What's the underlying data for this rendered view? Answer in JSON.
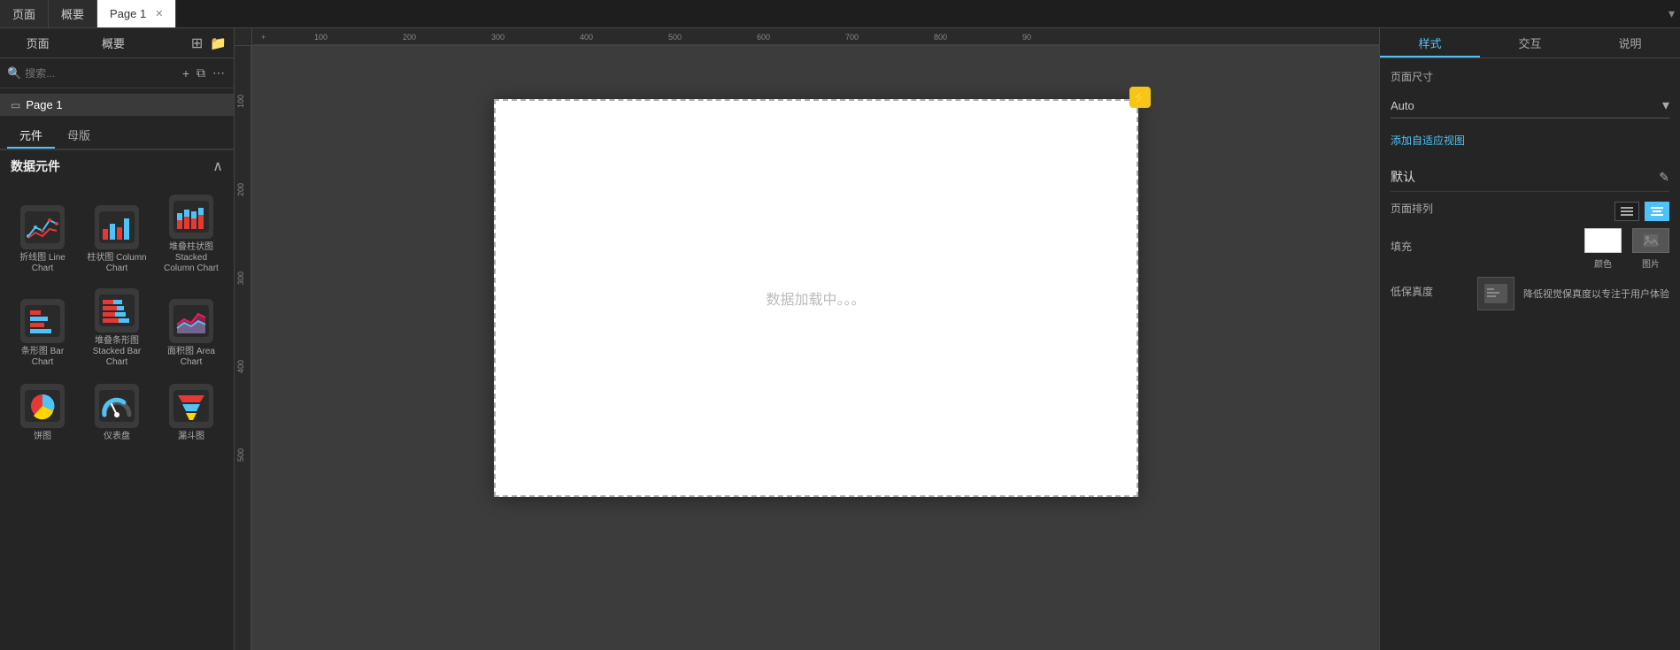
{
  "topBar": {
    "tabs": [
      {
        "id": "page",
        "label": "页面",
        "active": false
      },
      {
        "id": "overview",
        "label": "概要",
        "active": false
      },
      {
        "id": "page1",
        "label": "Page 1",
        "active": true,
        "closable": true
      }
    ],
    "scrollBtn": "▾"
  },
  "leftSidebar": {
    "navTabs": [
      {
        "id": "pages",
        "label": "页面",
        "active": false
      },
      {
        "id": "overview",
        "label": "概要",
        "active": false
      }
    ],
    "search": {
      "placeholder": "搜索...",
      "addIcon": "+",
      "copyIcon": "⧉",
      "moreIcon": "⋯"
    },
    "pages": [
      {
        "id": "page1",
        "label": "Page 1",
        "active": true
      }
    ],
    "componentsTabs": [
      {
        "id": "elements",
        "label": "元件",
        "active": true
      },
      {
        "id": "master",
        "label": "母版",
        "active": false
      }
    ],
    "dataSection": {
      "title": "数据元件",
      "toggleIcon": "∧"
    },
    "components": [
      {
        "id": "line-chart",
        "label": "折线图 Line Chart",
        "iconType": "line-chart"
      },
      {
        "id": "column-chart",
        "label": "柱状图 Column Chart",
        "iconType": "column-chart"
      },
      {
        "id": "stacked-column",
        "label": "堆叠柱状图 Stacked Column Chart",
        "iconType": "stacked-column"
      },
      {
        "id": "bar-chart",
        "label": "条形图 Bar Chart",
        "iconType": "bar-chart"
      },
      {
        "id": "stacked-bar",
        "label": "堆叠条形图 Stacked Bar Chart",
        "iconType": "stacked-bar"
      },
      {
        "id": "area-chart",
        "label": "面积图 Area Chart",
        "iconType": "area-chart"
      },
      {
        "id": "pie-chart",
        "label": "饼图",
        "iconType": "pie-chart"
      },
      {
        "id": "gauge-chart",
        "label": "仪表盘",
        "iconType": "gauge-chart"
      },
      {
        "id": "funnel-chart",
        "label": "漏斗图",
        "iconType": "funnel-chart"
      }
    ]
  },
  "canvas": {
    "loadingText": "数据加载中。。。",
    "lightningIcon": "⚡",
    "pageWidth": 728,
    "pageHeight": 450
  },
  "rightPanel": {
    "tabs": [
      {
        "id": "style",
        "label": "样式",
        "active": true
      },
      {
        "id": "interaction",
        "label": "交互",
        "active": false
      },
      {
        "id": "help",
        "label": "说明",
        "active": false
      }
    ],
    "pageSizeLabel": "页面尺寸",
    "pageSizeValue": "Auto",
    "addAdaptiveLabel": "添加自适应视图",
    "defaultSectionTitle": "默认",
    "editIcon": "✎",
    "pageAlignLabel": "页面排列",
    "alignOptions": [
      {
        "id": "left-align",
        "icon": "≡",
        "active": false
      },
      {
        "id": "center-align",
        "icon": "≡",
        "active": true
      }
    ],
    "fillLabel": "填充",
    "fillOptions": [
      {
        "id": "color-fill",
        "label": "颜色",
        "type": "color"
      },
      {
        "id": "image-fill",
        "label": "图片",
        "type": "image"
      }
    ],
    "lowFidelityLabel": "低保真度",
    "lowFidelityDesc": "降低视觉保真度以专注于用户体验"
  },
  "rulers": {
    "hMarks": [
      "100",
      "200",
      "300",
      "400",
      "500",
      "600",
      "700",
      "800",
      "90"
    ],
    "vMarks": [
      "100",
      "200",
      "300",
      "400",
      "500"
    ]
  }
}
